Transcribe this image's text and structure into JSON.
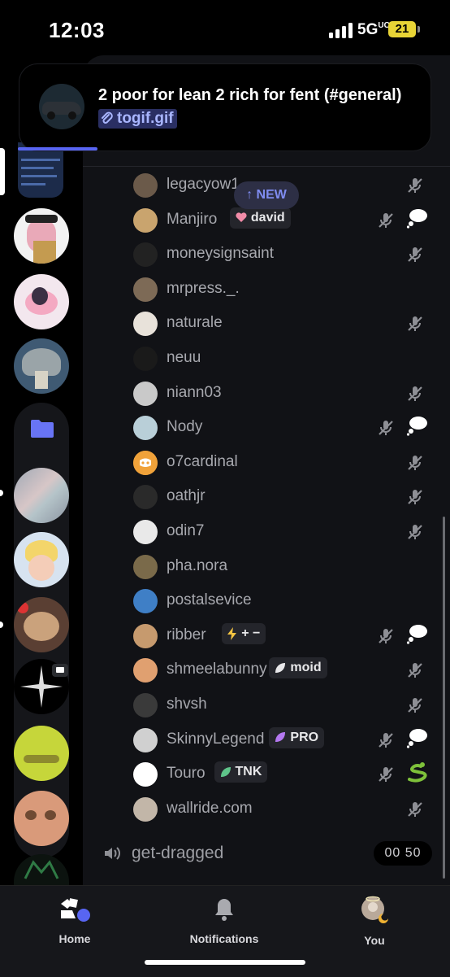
{
  "status": {
    "time": "12:03",
    "network": "5G",
    "network_sub": "UC",
    "battery": "21"
  },
  "notification": {
    "title": "2 poor for lean 2 rich for fent (#general)",
    "link_label": "togif.gif"
  },
  "new_pill": "↑ NEW",
  "members": [
    {
      "name": "legacyow1",
      "tag": null,
      "muted": true,
      "bubble": false
    },
    {
      "name": "Manjiro",
      "tag": "david",
      "muted": true,
      "bubble": true
    },
    {
      "name": "moneysignsaint",
      "tag": null,
      "muted": true,
      "bubble": false
    },
    {
      "name": "mrpress._.",
      "tag": null,
      "muted": false,
      "bubble": false
    },
    {
      "name": "naturale",
      "tag": null,
      "muted": true,
      "bubble": false
    },
    {
      "name": "neuu",
      "tag": null,
      "muted": false,
      "bubble": false
    },
    {
      "name": "niann03",
      "tag": null,
      "muted": true,
      "bubble": false
    },
    {
      "name": "Nody",
      "tag": null,
      "muted": true,
      "bubble": true
    },
    {
      "name": "o7cardinal",
      "tag": null,
      "muted": true,
      "bubble": false
    },
    {
      "name": "oathjr",
      "tag": null,
      "muted": true,
      "bubble": false
    },
    {
      "name": "odin7",
      "tag": null,
      "muted": true,
      "bubble": false
    },
    {
      "name": "pha.nora",
      "tag": null,
      "muted": false,
      "bubble": false
    },
    {
      "name": "postalsevice",
      "tag": null,
      "muted": false,
      "bubble": false
    },
    {
      "name": "ribber",
      "tag": "+ −",
      "muted": true,
      "bubble": true
    },
    {
      "name": "shmeelabunny",
      "tag": "moid",
      "muted": true,
      "bubble": false
    },
    {
      "name": "shvsh",
      "tag": null,
      "muted": true,
      "bubble": false
    },
    {
      "name": "SkinnyLegend",
      "tag": "PRO",
      "muted": true,
      "bubble": true
    },
    {
      "name": "Touro",
      "tag": "TNK",
      "muted": true,
      "bubble": false,
      "snake": true
    },
    {
      "name": "wallride.com",
      "tag": null,
      "muted": true,
      "bubble": false
    }
  ],
  "voice_channel": {
    "name": "get-dragged",
    "timer": "00 50"
  },
  "tabs": {
    "home": "Home",
    "notifications": "Notifications",
    "you": "You"
  },
  "colors": {
    "accent": "#5865f2",
    "background": "#111216",
    "muted_icon": "#8e8f95"
  }
}
